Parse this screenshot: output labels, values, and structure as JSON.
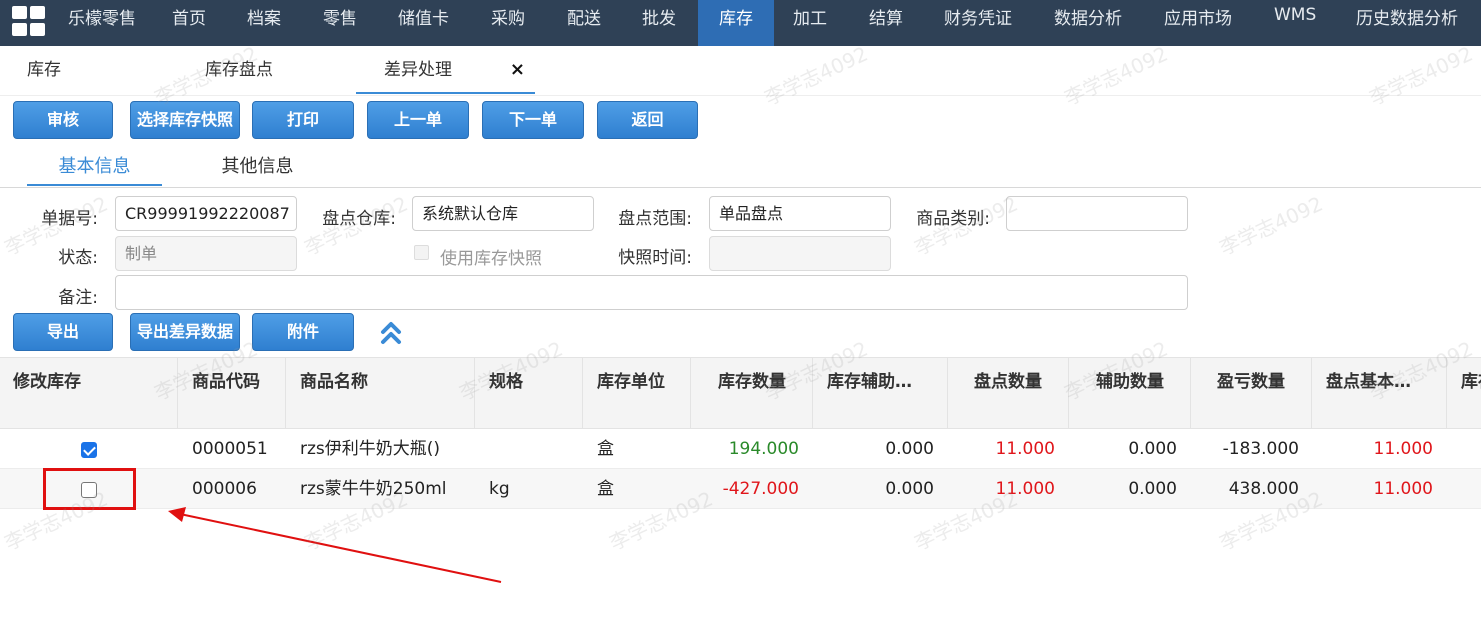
{
  "topnav": {
    "items": [
      "乐檬零售",
      "首页",
      "档案",
      "零售",
      "储值卡",
      "采购",
      "配送",
      "批发",
      "库存",
      "加工",
      "结算",
      "财务凭证",
      "数据分析",
      "应用市场",
      "WMS",
      "历史数据分析"
    ],
    "active": "库存"
  },
  "page_tabs": [
    "库存",
    "库存盘点",
    "差异处理"
  ],
  "toolbar": {
    "buttons": [
      "审核",
      "选择库存快照",
      "打印",
      "上一单",
      "下一单",
      "返回"
    ]
  },
  "subtabs": [
    "基本信息",
    "其他信息"
  ],
  "form": {
    "doc_no_label": "单据号:",
    "doc_no": "CR99991992220087",
    "warehouse_label": "盘点仓库:",
    "warehouse": "系统默认仓库",
    "range_label": "盘点范围:",
    "range": "单品盘点",
    "category_label": "商品类别:",
    "category": "",
    "status_label": "状态:",
    "status_placeholder": "制单",
    "use_snapshot_label": "使用库存快照",
    "snapshot_time_label": "快照时间:",
    "snapshot_time": "",
    "remark_label": "备注:",
    "remark": ""
  },
  "actions": {
    "buttons": [
      "导出",
      "导出差异数据",
      "附件"
    ]
  },
  "table": {
    "columns": [
      "修改库存",
      "商品代码",
      "商品名称",
      "规格",
      "库存单位",
      "库存数量",
      "库存辅助…",
      "盘点数量",
      "辅助数量",
      "盈亏数量",
      "盘点基本…",
      "库存"
    ],
    "rows": [
      {
        "modify": true,
        "code": "0000051",
        "name": "rzs伊利牛奶大瓶()",
        "spec": "",
        "unit": "盒",
        "stock_qty": "194.000",
        "stock_aux": "0.000",
        "count_qty": "11.000",
        "aux_qty": "0.000",
        "diff_qty": "-183.000",
        "count_base": "11.000"
      },
      {
        "modify": false,
        "code": "000006",
        "name": "rzs蒙牛牛奶250ml",
        "spec": "kg",
        "unit": "盒",
        "stock_qty": "-427.000",
        "stock_aux": "0.000",
        "count_qty": "11.000",
        "aux_qty": "0.000",
        "diff_qty": "438.000",
        "count_base": "11.000"
      }
    ]
  },
  "watermark": "李学志4092",
  "colors": {
    "nav_bg": "#2f4156",
    "nav_active": "#2e6db4",
    "button": "#3a8bd6",
    "accent": "#3a8bd6",
    "positive": "#2a8a2a",
    "negative": "#e0161b",
    "annotation": "#e01010"
  }
}
